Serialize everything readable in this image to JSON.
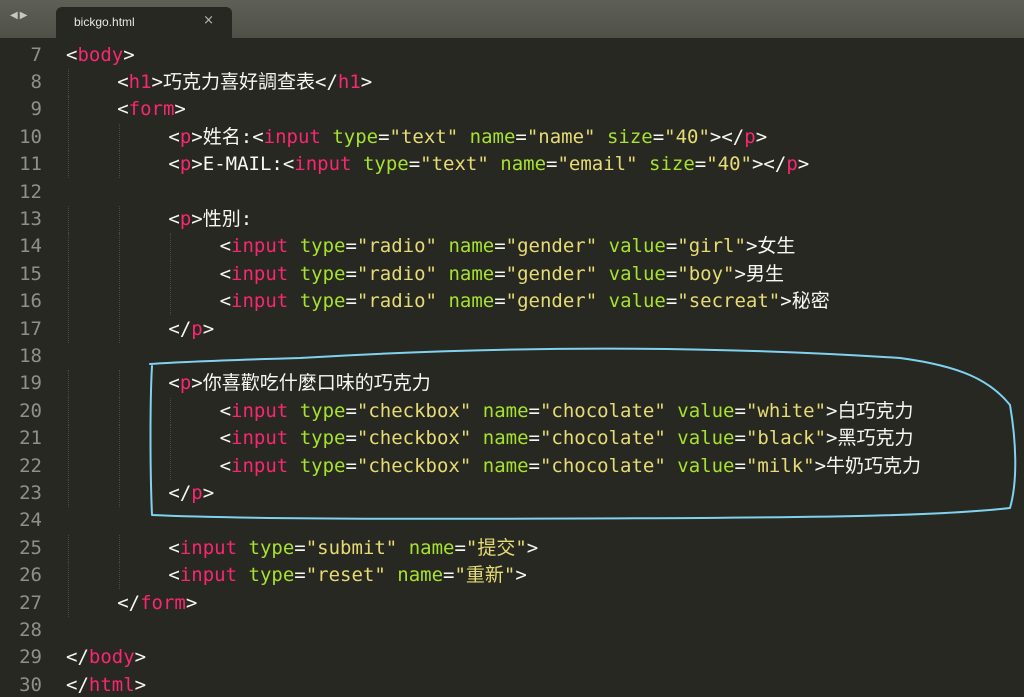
{
  "window": {
    "tab": {
      "title": "bickgo.html",
      "close_glyph": "×"
    },
    "nav_icons": [
      "triangle-left-icon",
      "triangle-right-icon"
    ]
  },
  "colors": {
    "background": "#272822",
    "tabbar": "#57584f",
    "line_number": "#8f908a",
    "tag": "#f92672",
    "attribute": "#a6e22e",
    "string": "#e6db74",
    "text": "#f8f8f2",
    "annotation": "#7fd3f0"
  },
  "editor": {
    "lines": [
      {
        "num": "7",
        "indent": 0,
        "tokens": [
          [
            "punct",
            "<"
          ],
          [
            "tag",
            "body"
          ],
          [
            "punct",
            ">"
          ]
        ]
      },
      {
        "num": "8",
        "indent": 1,
        "tokens": [
          [
            "punct",
            "<"
          ],
          [
            "tag",
            "h1"
          ],
          [
            "punct",
            ">"
          ],
          [
            "text",
            "巧克力喜好調查表"
          ],
          [
            "punct",
            "</"
          ],
          [
            "tag",
            "h1"
          ],
          [
            "punct",
            ">"
          ]
        ]
      },
      {
        "num": "9",
        "indent": 1,
        "tokens": [
          [
            "punct",
            "<"
          ],
          [
            "tag",
            "form"
          ],
          [
            "punct",
            ">"
          ]
        ]
      },
      {
        "num": "10",
        "indent": 2,
        "tokens": [
          [
            "punct",
            "<"
          ],
          [
            "tag",
            "p"
          ],
          [
            "punct",
            ">"
          ],
          [
            "text",
            "姓名"
          ],
          [
            "punct",
            ":<"
          ],
          [
            "tag",
            "input"
          ],
          [
            "punct",
            " "
          ],
          [
            "attr",
            "type"
          ],
          [
            "eq",
            "="
          ],
          [
            "str",
            "\"text\""
          ],
          [
            "punct",
            " "
          ],
          [
            "attr",
            "name"
          ],
          [
            "eq",
            "="
          ],
          [
            "str",
            "\"name\""
          ],
          [
            "punct",
            " "
          ],
          [
            "attr",
            "size"
          ],
          [
            "eq",
            "="
          ],
          [
            "str",
            "\"40\""
          ],
          [
            "punct",
            "></"
          ],
          [
            "tag",
            "p"
          ],
          [
            "punct",
            ">"
          ]
        ]
      },
      {
        "num": "11",
        "indent": 2,
        "tokens": [
          [
            "punct",
            "<"
          ],
          [
            "tag",
            "p"
          ],
          [
            "punct",
            ">"
          ],
          [
            "textmono",
            "E-MAIL"
          ],
          [
            "punct",
            ":<"
          ],
          [
            "tag",
            "input"
          ],
          [
            "punct",
            " "
          ],
          [
            "attr",
            "type"
          ],
          [
            "eq",
            "="
          ],
          [
            "str",
            "\"text\""
          ],
          [
            "punct",
            " "
          ],
          [
            "attr",
            "name"
          ],
          [
            "eq",
            "="
          ],
          [
            "str",
            "\"email\""
          ],
          [
            "punct",
            " "
          ],
          [
            "attr",
            "size"
          ],
          [
            "eq",
            "="
          ],
          [
            "str",
            "\"40\""
          ],
          [
            "punct",
            "></"
          ],
          [
            "tag",
            "p"
          ],
          [
            "punct",
            ">"
          ]
        ]
      },
      {
        "num": "12",
        "indent": 0,
        "tokens": []
      },
      {
        "num": "13",
        "indent": 2,
        "tokens": [
          [
            "punct",
            "<"
          ],
          [
            "tag",
            "p"
          ],
          [
            "punct",
            ">"
          ],
          [
            "text",
            "性別"
          ],
          [
            "punct",
            ":"
          ]
        ]
      },
      {
        "num": "14",
        "indent": 3,
        "tokens": [
          [
            "punct",
            "<"
          ],
          [
            "tag",
            "input"
          ],
          [
            "punct",
            " "
          ],
          [
            "attr",
            "type"
          ],
          [
            "eq",
            "="
          ],
          [
            "str",
            "\"radio\""
          ],
          [
            "punct",
            " "
          ],
          [
            "attr",
            "name"
          ],
          [
            "eq",
            "="
          ],
          [
            "str",
            "\"gender\""
          ],
          [
            "punct",
            " "
          ],
          [
            "attr",
            "value"
          ],
          [
            "eq",
            "="
          ],
          [
            "str",
            "\"girl\""
          ],
          [
            "punct",
            ">"
          ],
          [
            "text",
            "女生"
          ]
        ]
      },
      {
        "num": "15",
        "indent": 3,
        "tokens": [
          [
            "punct",
            "<"
          ],
          [
            "tag",
            "input"
          ],
          [
            "punct",
            " "
          ],
          [
            "attr",
            "type"
          ],
          [
            "eq",
            "="
          ],
          [
            "str",
            "\"radio\""
          ],
          [
            "punct",
            " "
          ],
          [
            "attr",
            "name"
          ],
          [
            "eq",
            "="
          ],
          [
            "str",
            "\"gender\""
          ],
          [
            "punct",
            " "
          ],
          [
            "attr",
            "value"
          ],
          [
            "eq",
            "="
          ],
          [
            "str",
            "\"boy\""
          ],
          [
            "punct",
            ">"
          ],
          [
            "text",
            "男生"
          ]
        ]
      },
      {
        "num": "16",
        "indent": 3,
        "tokens": [
          [
            "punct",
            "<"
          ],
          [
            "tag",
            "input"
          ],
          [
            "punct",
            " "
          ],
          [
            "attr",
            "type"
          ],
          [
            "eq",
            "="
          ],
          [
            "str",
            "\"radio\""
          ],
          [
            "punct",
            " "
          ],
          [
            "attr",
            "name"
          ],
          [
            "eq",
            "="
          ],
          [
            "str",
            "\"gender\""
          ],
          [
            "punct",
            " "
          ],
          [
            "attr",
            "value"
          ],
          [
            "eq",
            "="
          ],
          [
            "str",
            "\"secreat\""
          ],
          [
            "punct",
            ">"
          ],
          [
            "text",
            "秘密"
          ]
        ]
      },
      {
        "num": "17",
        "indent": 2,
        "tokens": [
          [
            "punct",
            "</"
          ],
          [
            "tag",
            "p"
          ],
          [
            "punct",
            ">"
          ]
        ]
      },
      {
        "num": "18",
        "indent": 0,
        "tokens": []
      },
      {
        "num": "19",
        "indent": 2,
        "tokens": [
          [
            "punct",
            "<"
          ],
          [
            "tag",
            "p"
          ],
          [
            "punct",
            ">"
          ],
          [
            "text",
            "你喜歡吃什麼口味的巧克力"
          ]
        ]
      },
      {
        "num": "20",
        "indent": 3,
        "tokens": [
          [
            "punct",
            "<"
          ],
          [
            "tag",
            "input"
          ],
          [
            "punct",
            " "
          ],
          [
            "attr",
            "type"
          ],
          [
            "eq",
            "="
          ],
          [
            "str",
            "\"checkbox\""
          ],
          [
            "punct",
            " "
          ],
          [
            "attr",
            "name"
          ],
          [
            "eq",
            "="
          ],
          [
            "str",
            "\"chocolate\""
          ],
          [
            "punct",
            " "
          ],
          [
            "attr",
            "value"
          ],
          [
            "eq",
            "="
          ],
          [
            "str",
            "\"white\""
          ],
          [
            "punct",
            ">"
          ],
          [
            "text",
            "白巧克力"
          ]
        ]
      },
      {
        "num": "21",
        "indent": 3,
        "tokens": [
          [
            "punct",
            "<"
          ],
          [
            "tag",
            "input"
          ],
          [
            "punct",
            " "
          ],
          [
            "attr",
            "type"
          ],
          [
            "eq",
            "="
          ],
          [
            "str",
            "\"checkbox\""
          ],
          [
            "punct",
            " "
          ],
          [
            "attr",
            "name"
          ],
          [
            "eq",
            "="
          ],
          [
            "str",
            "\"chocolate\""
          ],
          [
            "punct",
            " "
          ],
          [
            "attr",
            "value"
          ],
          [
            "eq",
            "="
          ],
          [
            "str",
            "\"black\""
          ],
          [
            "punct",
            ">"
          ],
          [
            "text",
            "黑巧克力"
          ]
        ]
      },
      {
        "num": "22",
        "indent": 3,
        "tokens": [
          [
            "punct",
            "<"
          ],
          [
            "tag",
            "input"
          ],
          [
            "punct",
            " "
          ],
          [
            "attr",
            "type"
          ],
          [
            "eq",
            "="
          ],
          [
            "str",
            "\"checkbox\""
          ],
          [
            "punct",
            " "
          ],
          [
            "attr",
            "name"
          ],
          [
            "eq",
            "="
          ],
          [
            "str",
            "\"chocolate\""
          ],
          [
            "punct",
            " "
          ],
          [
            "attr",
            "value"
          ],
          [
            "eq",
            "="
          ],
          [
            "str",
            "\"milk\""
          ],
          [
            "punct",
            ">"
          ],
          [
            "text",
            "牛奶巧克力"
          ]
        ]
      },
      {
        "num": "23",
        "indent": 2,
        "tokens": [
          [
            "punct",
            "</"
          ],
          [
            "tag",
            "p"
          ],
          [
            "punct",
            ">"
          ]
        ]
      },
      {
        "num": "24",
        "indent": 0,
        "tokens": []
      },
      {
        "num": "25",
        "indent": 2,
        "tokens": [
          [
            "punct",
            "<"
          ],
          [
            "tag",
            "input"
          ],
          [
            "punct",
            " "
          ],
          [
            "attr",
            "type"
          ],
          [
            "eq",
            "="
          ],
          [
            "str",
            "\"submit\""
          ],
          [
            "punct",
            " "
          ],
          [
            "attr",
            "name"
          ],
          [
            "eq",
            "="
          ],
          [
            "str",
            "\"提交\""
          ],
          [
            "punct",
            ">"
          ]
        ]
      },
      {
        "num": "26",
        "indent": 2,
        "tokens": [
          [
            "punct",
            "<"
          ],
          [
            "tag",
            "input"
          ],
          [
            "punct",
            " "
          ],
          [
            "attr",
            "type"
          ],
          [
            "eq",
            "="
          ],
          [
            "str",
            "\"reset\""
          ],
          [
            "punct",
            " "
          ],
          [
            "attr",
            "name"
          ],
          [
            "eq",
            "="
          ],
          [
            "str",
            "\"重新\""
          ],
          [
            "punct",
            ">"
          ]
        ]
      },
      {
        "num": "27",
        "indent": 1,
        "tokens": [
          [
            "punct",
            "</"
          ],
          [
            "tag",
            "form"
          ],
          [
            "punct",
            ">"
          ]
        ]
      },
      {
        "num": "28",
        "indent": 0,
        "tokens": []
      },
      {
        "num": "29",
        "indent": 0,
        "tokens": [
          [
            "punct",
            "</"
          ],
          [
            "tag",
            "body"
          ],
          [
            "punct",
            ">"
          ]
        ]
      },
      {
        "num": "30",
        "indent": 0,
        "tokens": [
          [
            "punct",
            "</"
          ],
          [
            "tag",
            "html"
          ],
          [
            "punct",
            ">"
          ]
        ]
      }
    ]
  },
  "annotation": {
    "shape": "freehand-loop",
    "covers_lines": [
      "19",
      "23"
    ]
  }
}
